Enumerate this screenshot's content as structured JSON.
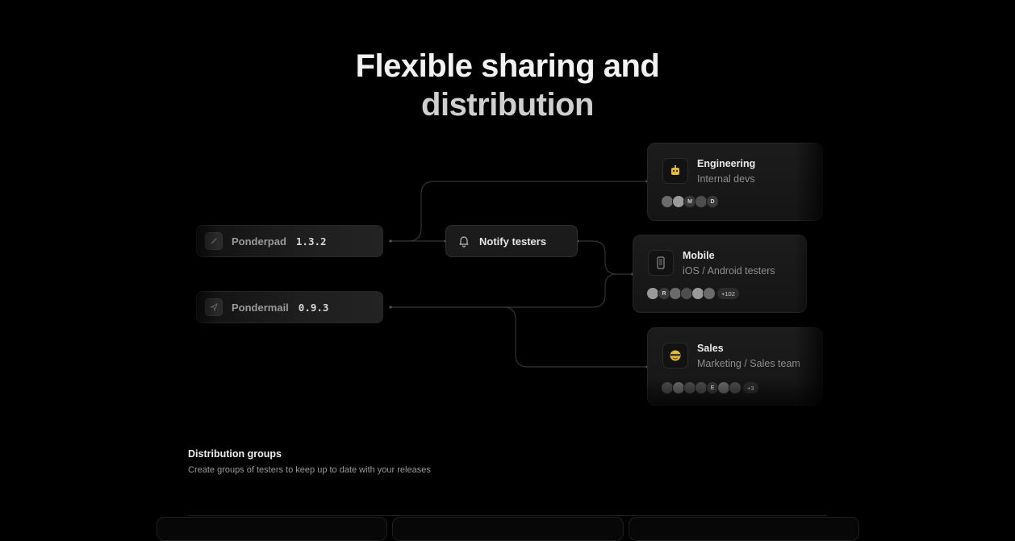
{
  "hero": {
    "line1": "Flexible sharing and",
    "line2": "distribution"
  },
  "apps": [
    {
      "name": "Ponderpad",
      "version": "1.3.2",
      "icon": "pencil-icon"
    },
    {
      "name": "Pondermail",
      "version": "0.9.3",
      "icon": "send-icon"
    }
  ],
  "notify": {
    "label": "Notify testers",
    "icon": "bell-icon"
  },
  "groups": [
    {
      "name": "Engineering",
      "description": "Internal devs",
      "icon": "robot-emoji-icon",
      "avatar_letters": [
        "M",
        "D"
      ],
      "count": ""
    },
    {
      "name": "Mobile",
      "description": "iOS / Android testers",
      "icon": "phone-icon",
      "avatar_letters": [
        "R"
      ],
      "count": "+102"
    },
    {
      "name": "Sales",
      "description": "Marketing / Sales team",
      "icon": "emoji-face-icon",
      "avatar_letters": [
        "E"
      ],
      "count": "+3"
    }
  ],
  "section": {
    "title": "Distribution groups",
    "description": "Create groups of testers to keep up to date with your releases"
  },
  "colors": {
    "background": "#000000",
    "card": "#1c1c1c",
    "connector": "#333333",
    "accent_yellow": "#e2b93b"
  }
}
